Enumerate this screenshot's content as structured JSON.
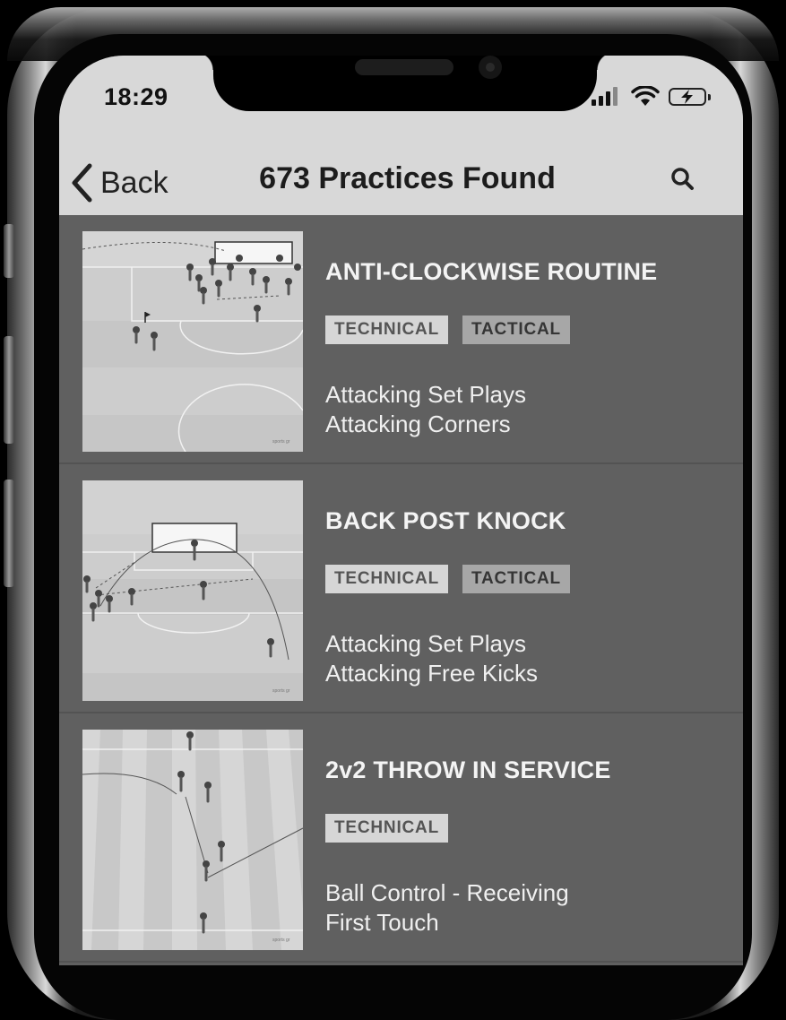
{
  "status_bar": {
    "time": "18:29"
  },
  "nav": {
    "back_label": "Back",
    "title": "673 Practices Found",
    "icons": {
      "back": "chevron-left-icon",
      "search": "search-icon"
    }
  },
  "practices": [
    {
      "title": "ANTI-CLOCKWISE ROUTINE",
      "tags": [
        "TECHNICAL",
        "TACTICAL"
      ],
      "categories": [
        "Attacking Set Plays",
        "Attacking Corners"
      ],
      "watermark": "sports gr"
    },
    {
      "title": "BACK POST KNOCK",
      "tags": [
        "TECHNICAL",
        "TACTICAL"
      ],
      "categories": [
        "Attacking Set Plays",
        "Attacking Free Kicks"
      ],
      "watermark": "sports gr"
    },
    {
      "title": "2v2 THROW IN SERVICE",
      "tags": [
        "TECHNICAL"
      ],
      "categories": [
        "Ball Control - Receiving",
        "First Touch"
      ],
      "watermark": "sports gr"
    }
  ]
}
